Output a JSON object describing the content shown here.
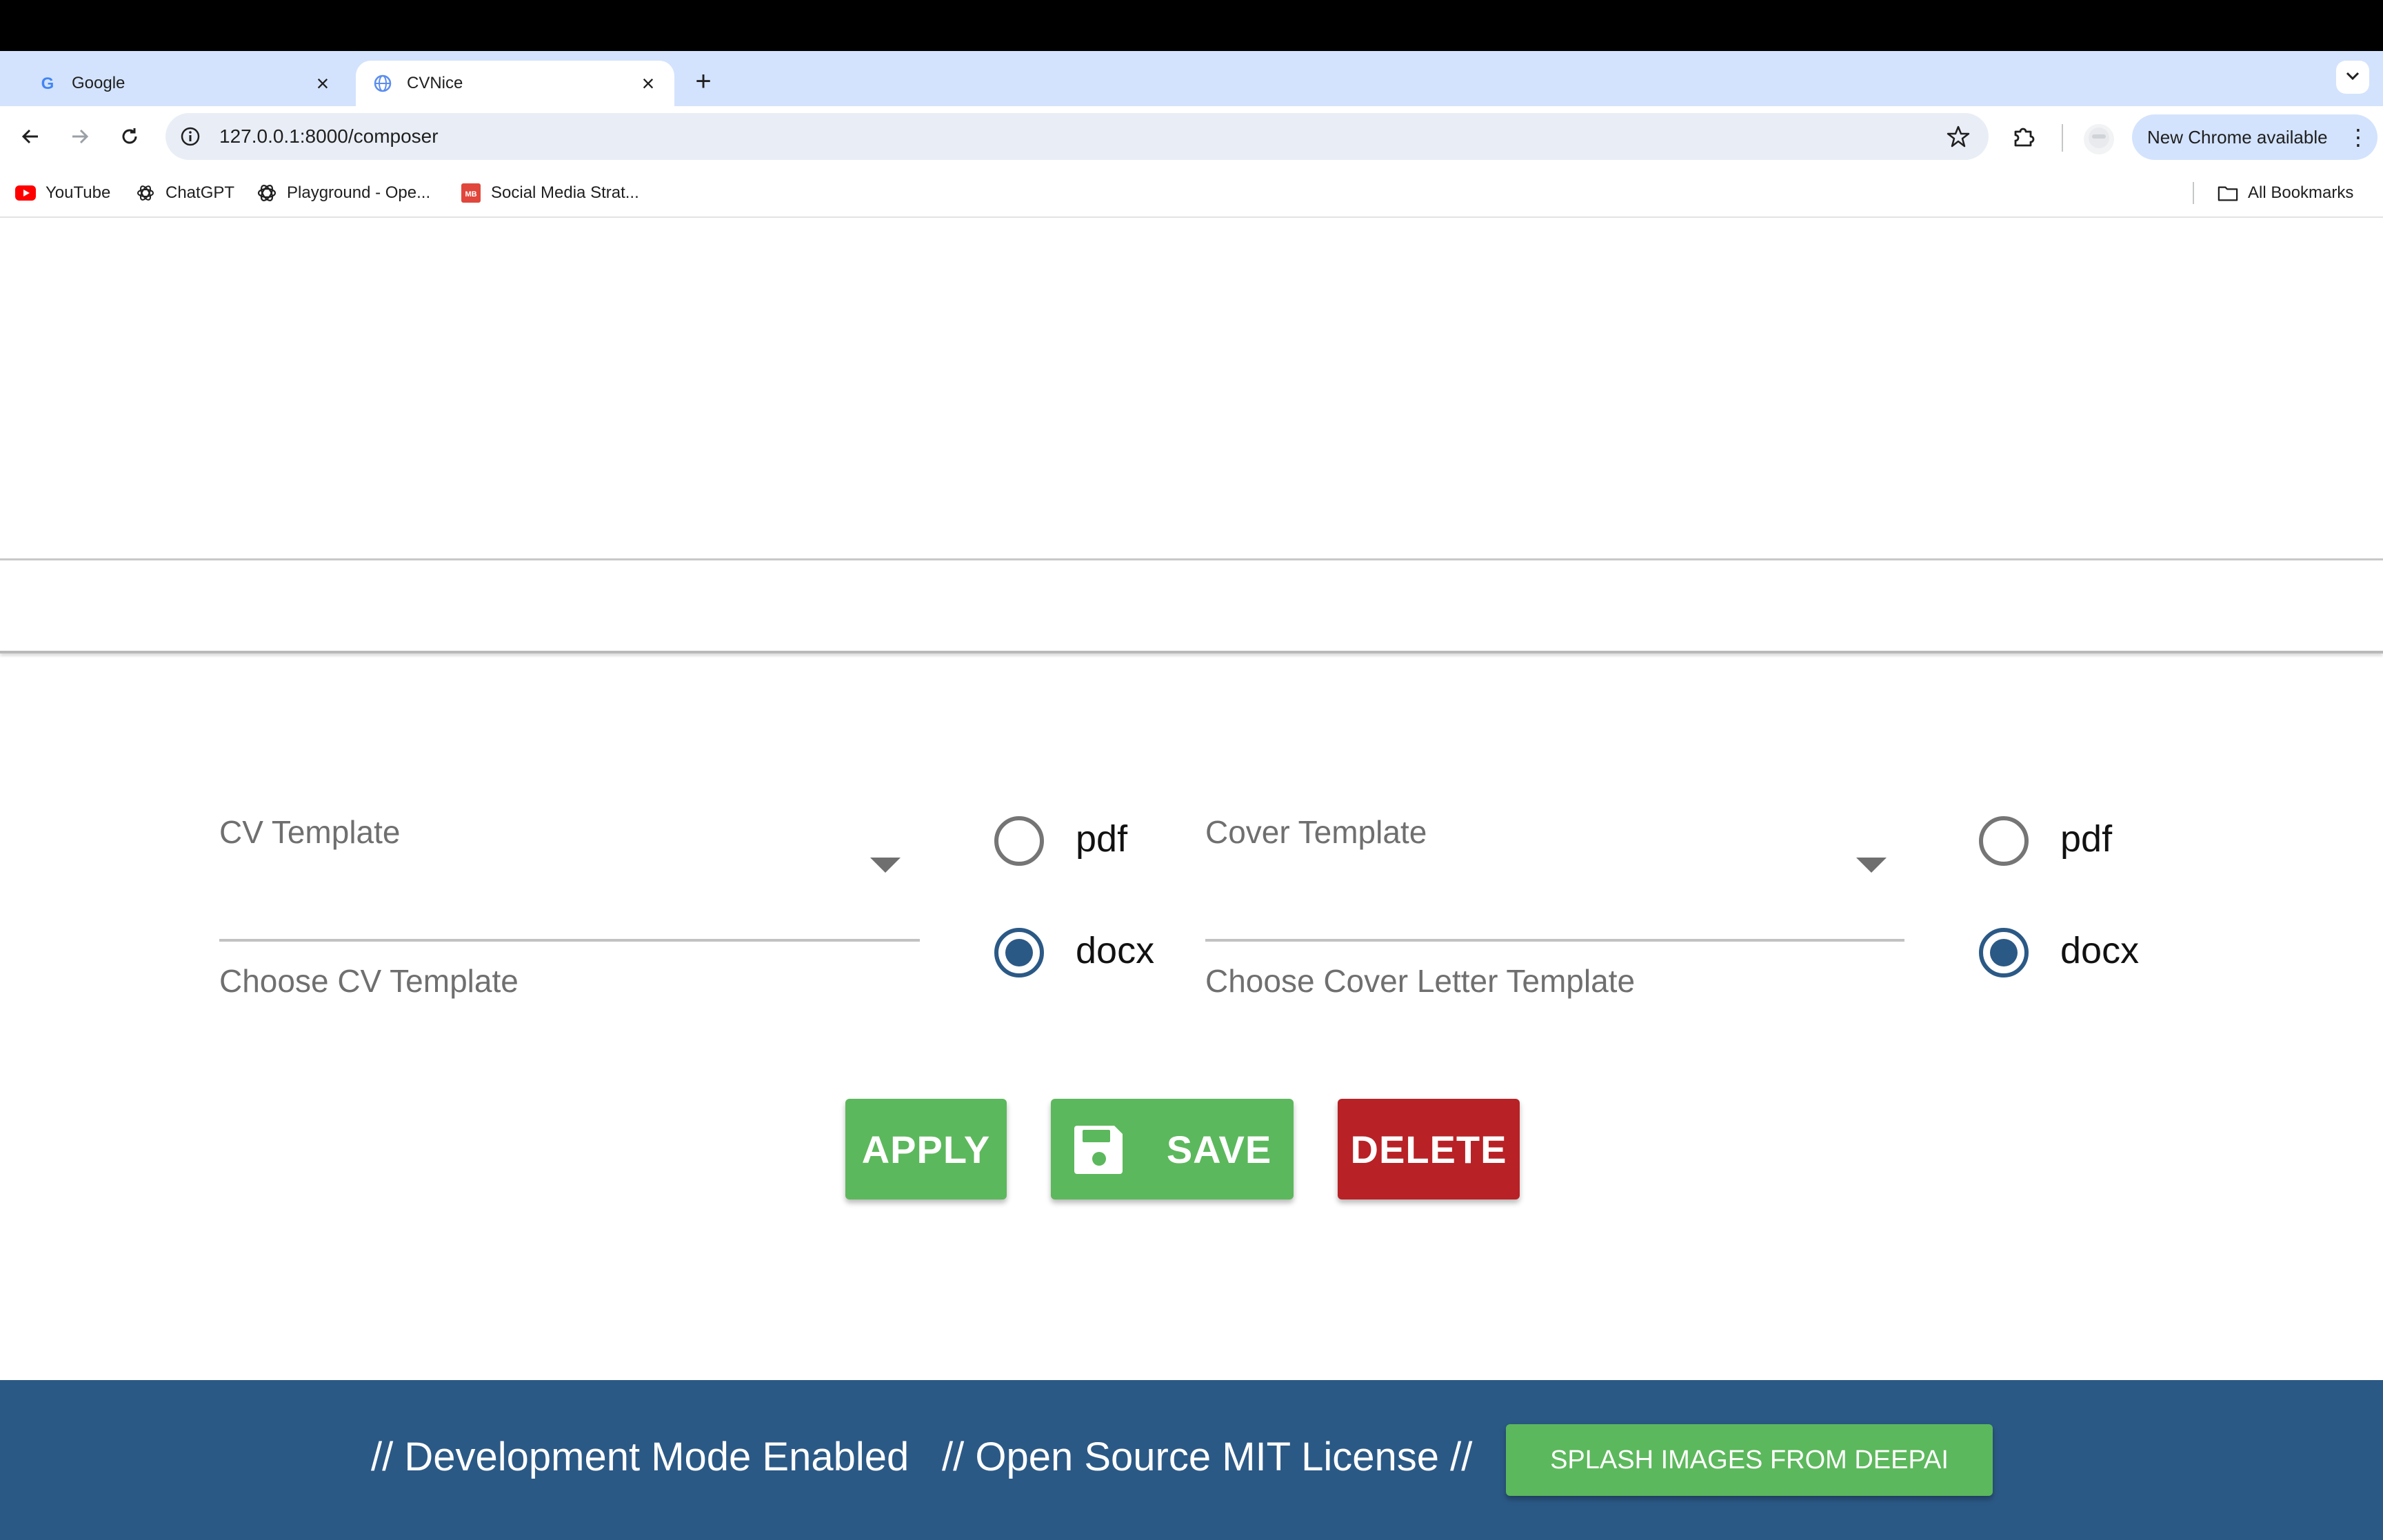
{
  "browser": {
    "tabs": [
      {
        "title": "Google",
        "icon": "google-icon",
        "active": false
      },
      {
        "title": "CVNice",
        "icon": "globe-icon",
        "active": true
      }
    ],
    "address_url": "127.0.0.1:8000/composer",
    "update_label": "New Chrome available",
    "bookmarks": [
      {
        "label": "YouTube",
        "icon": "youtube-icon"
      },
      {
        "label": "ChatGPT",
        "icon": "chatgpt-icon"
      },
      {
        "label": "Playground - Ope...",
        "icon": "openai-icon"
      },
      {
        "label": "Social Media Strat...",
        "icon": "mb-icon",
        "icon_text": "MB"
      }
    ],
    "all_bookmarks_label": "All Bookmarks"
  },
  "composer": {
    "cv_template": {
      "label": "CV Template",
      "hint": "Choose CV Template",
      "value": ""
    },
    "cv_format": {
      "options": [
        "pdf",
        "docx"
      ],
      "selected": "docx"
    },
    "cover_template": {
      "label": "Cover Template",
      "hint": "Choose Cover Letter Template",
      "value": ""
    },
    "cover_format": {
      "options": [
        "pdf",
        "docx"
      ],
      "selected": "docx"
    },
    "actions": {
      "apply_label": "APPLY",
      "save_label": "SAVE",
      "delete_label": "DELETE"
    }
  },
  "footer": {
    "dev_mode_text": "// Development Mode Enabled",
    "license_text": "// Open Source MIT License //",
    "splash_button_label": "SPLASH IMAGES FROM DEEPAI"
  },
  "colors": {
    "primary_blue": "#2b5986",
    "success_green": "#5cb85c",
    "danger_red": "#b82125",
    "chrome_tabstrip": "#d3e3fd"
  }
}
